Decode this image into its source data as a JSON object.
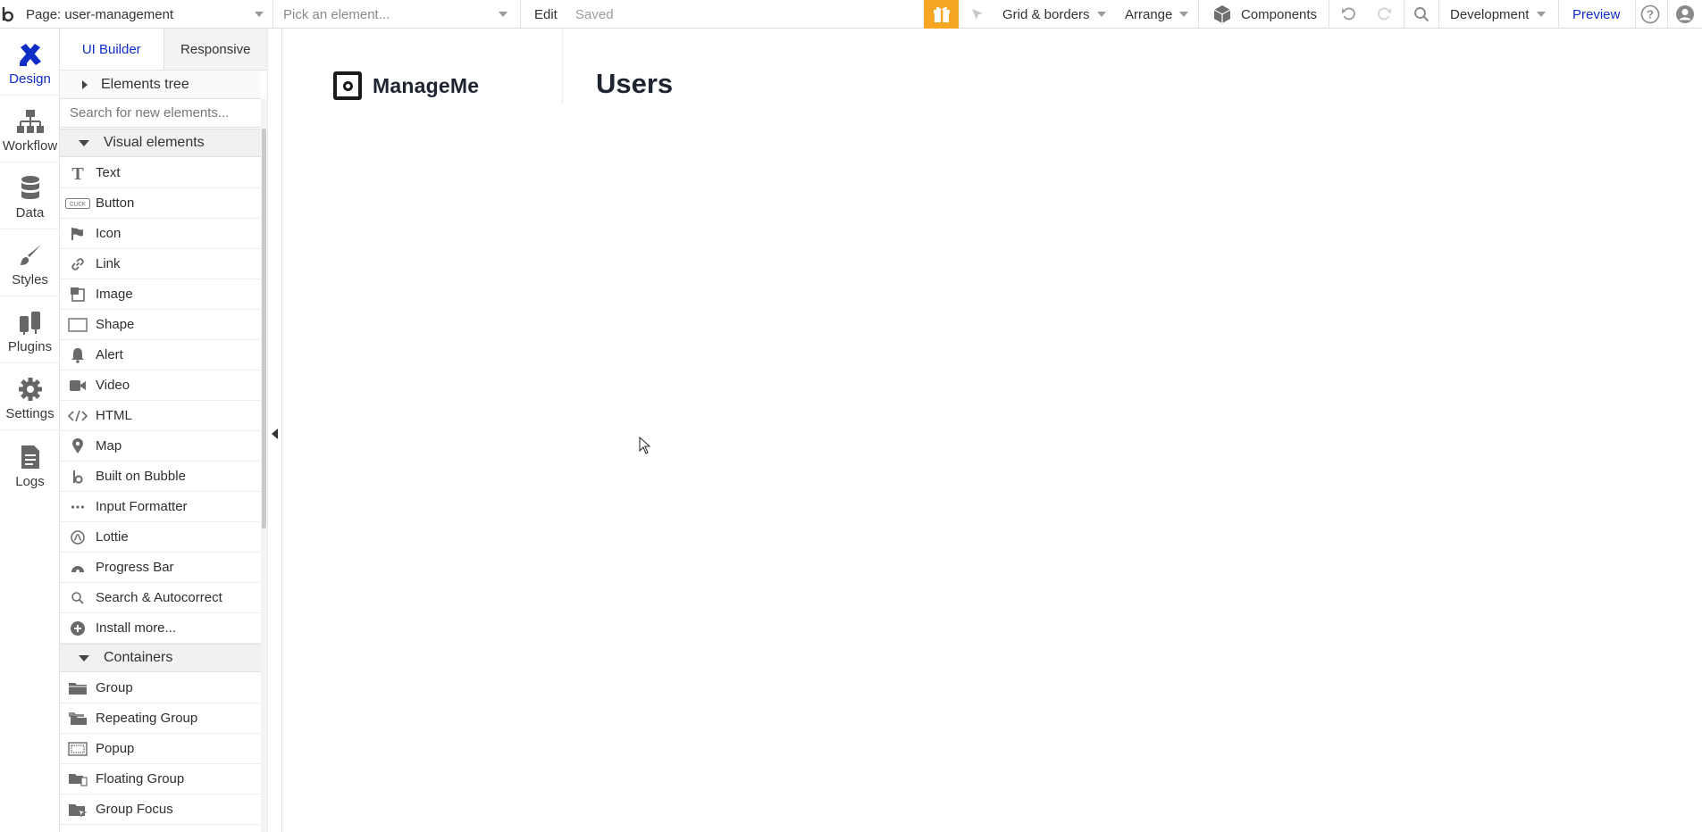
{
  "topbar": {
    "app_logo_icon": "bubble-logo-icon",
    "page_selector": "Page: user-management",
    "element_picker_placeholder": "Pick an element...",
    "edit_label": "Edit",
    "save_status": "Saved",
    "gift_icon": "gift-icon",
    "gift_color": "#f5a623",
    "inspect_icon": "pointer-icon",
    "grid_label": "Grid & borders",
    "arrange_label": "Arrange",
    "components_icon": "cube-icon",
    "components_label": "Components",
    "undo_icon": "undo-icon",
    "redo_icon": "redo-icon",
    "search_icon": "search-icon",
    "version_label": "Development",
    "preview_label": "Preview",
    "help_icon": "help-icon",
    "account_icon": "account-icon",
    "accent_color": "#0f2cc7"
  },
  "rail": {
    "items": [
      {
        "label": "Design",
        "icon": "design-icon",
        "active": true
      },
      {
        "label": "Workflow",
        "icon": "workflow-icon"
      },
      {
        "label": "Data",
        "icon": "database-icon"
      },
      {
        "label": "Styles",
        "icon": "brush-icon"
      },
      {
        "label": "Plugins",
        "icon": "plugin-icon"
      },
      {
        "label": "Settings",
        "icon": "gear-icon"
      },
      {
        "label": "Logs",
        "icon": "document-icon"
      }
    ]
  },
  "panel": {
    "tabs": [
      {
        "label": "UI Builder",
        "active": true
      },
      {
        "label": "Responsive"
      }
    ],
    "elements_tree_label": "Elements tree",
    "search_placeholder": "Search for new elements...",
    "visual_section": "Visual elements",
    "visual_elements": [
      {
        "label": "Text",
        "icon": "text-icon"
      },
      {
        "label": "Button",
        "icon": "button-icon"
      },
      {
        "label": "Icon",
        "icon": "flag-icon"
      },
      {
        "label": "Link",
        "icon": "link-icon"
      },
      {
        "label": "Image",
        "icon": "image-icon"
      },
      {
        "label": "Shape",
        "icon": "rectangle-icon"
      },
      {
        "label": "Alert",
        "icon": "bell-icon"
      },
      {
        "label": "Video",
        "icon": "video-icon"
      },
      {
        "label": "HTML",
        "icon": "code-icon"
      },
      {
        "label": "Map",
        "icon": "map-pin-icon"
      },
      {
        "label": "Built on Bubble",
        "icon": "bubble-b-icon"
      },
      {
        "label": "Input Formatter",
        "icon": "dots-icon"
      },
      {
        "label": "Lottie",
        "icon": "lottie-icon"
      },
      {
        "label": "Progress Bar",
        "icon": "progress-icon"
      },
      {
        "label": "Search & Autocorrect",
        "icon": "search-icon"
      },
      {
        "label": "Install more...",
        "icon": "plus-circle-icon"
      }
    ],
    "containers_section": "Containers",
    "containers": [
      {
        "label": "Group",
        "icon": "folder-icon"
      },
      {
        "label": "Repeating Group",
        "icon": "folders-icon"
      },
      {
        "label": "Popup",
        "icon": "popup-icon"
      },
      {
        "label": "Floating Group",
        "icon": "floating-folder-icon"
      },
      {
        "label": "Group Focus",
        "icon": "focus-folder-icon"
      }
    ]
  },
  "canvas": {
    "brand_name": "ManageMe",
    "brand_icon": "manageme-logo-icon",
    "page_heading": "Users"
  }
}
